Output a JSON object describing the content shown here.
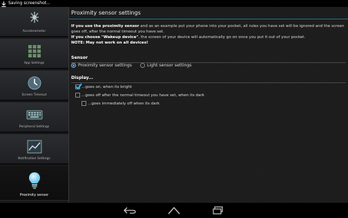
{
  "status_bar": {
    "notification_text": "Saving screenshot...",
    "download_icon": "download-arrow-icon"
  },
  "sidebar": {
    "items": [
      {
        "label": "Accelerometer",
        "icon": "accelerometer-icon",
        "selected": false
      },
      {
        "label": "App Settings",
        "icon": "grid-icon",
        "selected": false
      },
      {
        "label": "Screen Timeout",
        "icon": "clock-icon",
        "selected": false
      },
      {
        "label": "Peripheral Settings",
        "icon": "keyboard-icon",
        "selected": false
      },
      {
        "label": "Notification Settings",
        "icon": "chart-icon",
        "selected": false
      },
      {
        "label": "Proximity sensor",
        "icon": "lightbulb-icon",
        "selected": true
      }
    ]
  },
  "main": {
    "title": "Proximity sensor settings",
    "description": {
      "line1_prefix": "If you use the proximity sensor",
      "line1_suffix": " and as an example put your phone into your pocket, all rules you have set will be ignored and the screen goes off, after the normal timeout you have set.",
      "line2_prefix": "If you choose \"Wakeup device\"",
      "line2_suffix": ", the screen of your device will automatically go on once you put it out of your pocket.",
      "note": "NOTE: May not work on all devices!"
    },
    "sensor_section": {
      "heading": "Sensor",
      "options": [
        {
          "label": "Proximity sensor settings",
          "checked": true
        },
        {
          "label": "Light sensor settings",
          "checked": false
        }
      ]
    },
    "display_section": {
      "heading": "Display...",
      "options": [
        {
          "label": "...goes on, when its bright",
          "checked": true
        },
        {
          "label": "...goes off after the normal timeout you have set, when its dark",
          "checked": false
        },
        {
          "label": "...goes immediately off when its dark",
          "checked": false
        }
      ]
    }
  },
  "nav_bar": {
    "buttons": [
      "back-icon",
      "home-icon",
      "recent-apps-icon"
    ]
  },
  "colors": {
    "accent": "#33b5e5",
    "background": "#1c1c1c",
    "sidebar": "#2b2d30"
  }
}
